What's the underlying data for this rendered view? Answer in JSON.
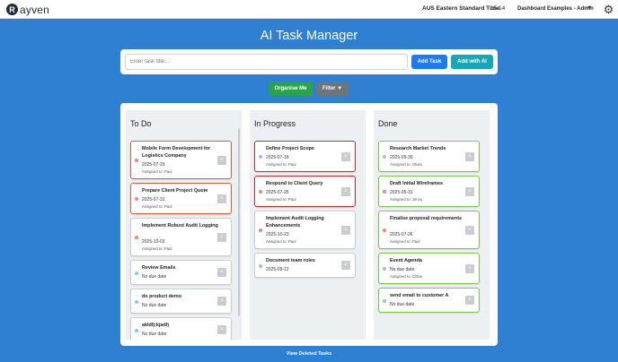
{
  "header": {
    "logo_mark": "R",
    "logo_text": "ayven",
    "timezone": "AUS Eastern Standard Time",
    "time": "15:14",
    "dashboard": "Dashboard Examples - Admin",
    "icons": [
      "settings-gear-icon",
      "chevron-down-icon"
    ]
  },
  "page": {
    "title": "AI Task Manager",
    "input_placeholder": "Enter task title...",
    "add_task": "Add Task",
    "add_with_ai": "Add with AI",
    "organise": "Organise Me",
    "filter": "Filter ▼",
    "view_deleted": "View Deleted Tasks"
  },
  "columns": {
    "todo": {
      "title": "To Do",
      "cards": [
        {
          "title": "Mobile Form Development for Logistics Company",
          "date": "2025-07-29",
          "assignee": "Assigned to: Paul",
          "priority": "high"
        },
        {
          "title": "Prepare Client Project Quote",
          "date": "2025-07-31",
          "assignee": "Assigned to: Paul",
          "priority": "high"
        },
        {
          "title": "Implement Robust Audit Logging",
          "date": "2025-10-03",
          "assignee": "Assigned to: Paul",
          "priority": "high"
        },
        {
          "title": "Review Emails",
          "date": "No due date",
          "priority": "low"
        },
        {
          "title": "do product demo",
          "date": "No due date",
          "priority": "low"
        },
        {
          "title": "akldfj;kjadfj",
          "date": "No due date",
          "priority": "low"
        }
      ]
    },
    "progress": {
      "title": "In Progress",
      "cards": [
        {
          "title": "Define Project Scope",
          "date": "2025-07-18",
          "assignee": "Assigned to: Paul",
          "priority": "low"
        },
        {
          "title": "Respond to Client Query",
          "date": "2025-07-25",
          "assignee": "Assigned to: Paul",
          "priority": "high"
        },
        {
          "title": "Implement Audit Logging Enhancements",
          "date": "2025-10-23",
          "assignee": "Assigned to: Paul",
          "priority": "high"
        },
        {
          "title": "Document team roles",
          "date": "2025-09-12",
          "priority": "low"
        }
      ]
    },
    "done": {
      "title": "Done",
      "cards": [
        {
          "title": "Research Market Trends",
          "date": "2025-05-30",
          "assignee": "Assigned to: Olivia",
          "priority": "low"
        },
        {
          "title": "Draft Initial Wireframes",
          "date": "2025-05-31",
          "assignee": "Assigned to: Jenny",
          "priority": "high"
        },
        {
          "title": "Finalise proposal requirements",
          "date": "2025-07-26",
          "assignee": "Assigned to: Paul",
          "priority": "high"
        },
        {
          "title": "Event Agenda",
          "date": "No due date",
          "assignee": "Assigned to: Chloe",
          "priority": "low"
        },
        {
          "title": "send email to customer A",
          "date": "No due date",
          "priority": "low"
        }
      ]
    }
  },
  "colors": {
    "background": "#2f7fd3",
    "add_task": "#1a7cf0",
    "add_with_ai": "#17a7b8",
    "organise": "#2ba34a",
    "filter": "#6c757d",
    "overdue_border": "#d92525",
    "done_border": "#7cc74a"
  }
}
